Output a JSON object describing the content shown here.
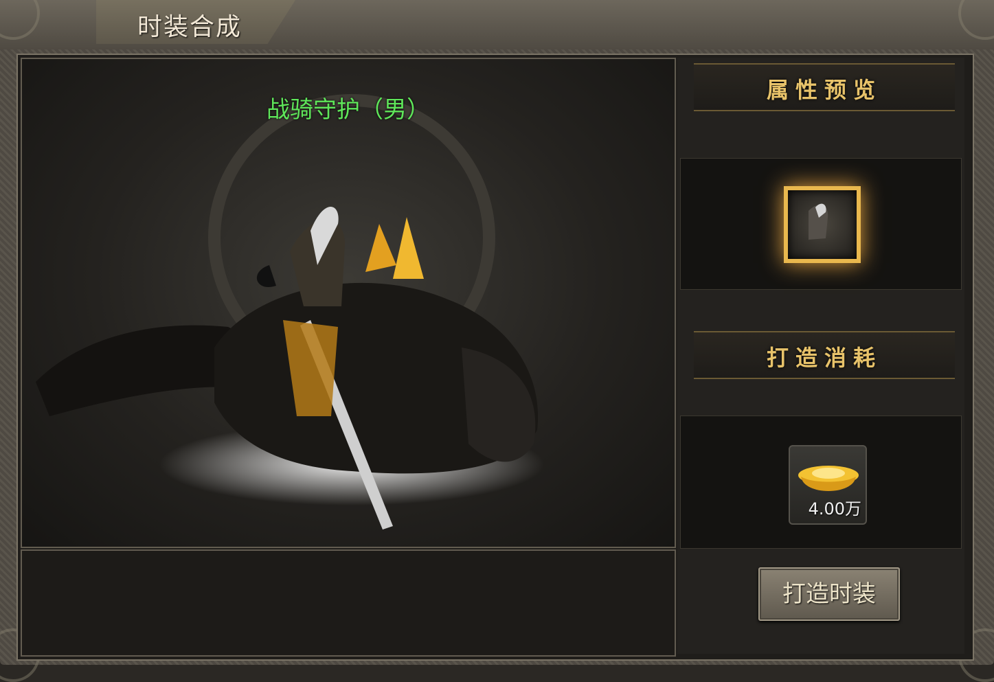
{
  "window": {
    "title": "时装合成"
  },
  "preview": {
    "item_name": "战骑守护（男）"
  },
  "sidebar": {
    "attr_header": "属性预览",
    "cost_header": "打造消耗",
    "cost": {
      "currency_icon": "gold-ingot-icon",
      "amount": "4.00万"
    }
  },
  "actions": {
    "craft_label": "打造时装"
  },
  "colors": {
    "item_name": "#5fe65a",
    "section_header": "#e8c36a",
    "frame_gold": "#e9b84e"
  }
}
